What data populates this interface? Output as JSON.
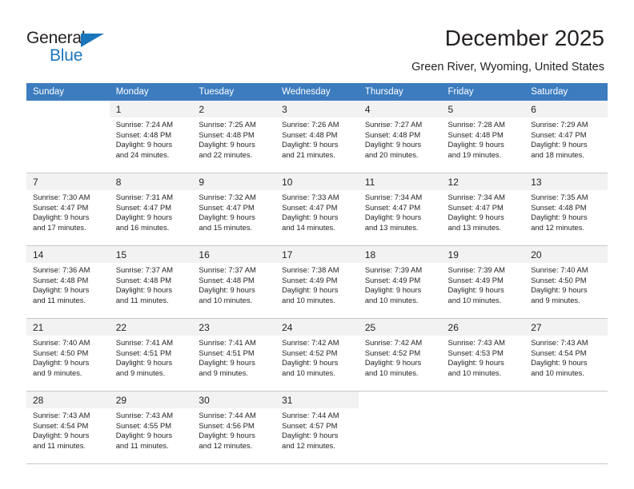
{
  "brand": {
    "name_top": "General",
    "name_bottom": "Blue",
    "accent_color": "#1b75bb",
    "triangle_icon": "triangle-icon"
  },
  "header": {
    "title": "December 2025",
    "subtitle": "Green River, Wyoming, United States"
  },
  "calendar": {
    "header_bg": "#3c7cbf",
    "header_text_color": "#ffffff",
    "datenum_bg": "#f2f2f2",
    "grid_line_color": "#c8c8c8",
    "weekdays": [
      "Sunday",
      "Monday",
      "Tuesday",
      "Wednesday",
      "Thursday",
      "Friday",
      "Saturday"
    ],
    "weeks": [
      [
        {
          "date": "",
          "sunrise": "",
          "sunset": "",
          "daylight_line1": "",
          "daylight_line2": "",
          "empty": true
        },
        {
          "date": "1",
          "sunrise": "Sunrise: 7:24 AM",
          "sunset": "Sunset: 4:48 PM",
          "daylight_line1": "Daylight: 9 hours",
          "daylight_line2": "and 24 minutes."
        },
        {
          "date": "2",
          "sunrise": "Sunrise: 7:25 AM",
          "sunset": "Sunset: 4:48 PM",
          "daylight_line1": "Daylight: 9 hours",
          "daylight_line2": "and 22 minutes."
        },
        {
          "date": "3",
          "sunrise": "Sunrise: 7:26 AM",
          "sunset": "Sunset: 4:48 PM",
          "daylight_line1": "Daylight: 9 hours",
          "daylight_line2": "and 21 minutes."
        },
        {
          "date": "4",
          "sunrise": "Sunrise: 7:27 AM",
          "sunset": "Sunset: 4:48 PM",
          "daylight_line1": "Daylight: 9 hours",
          "daylight_line2": "and 20 minutes."
        },
        {
          "date": "5",
          "sunrise": "Sunrise: 7:28 AM",
          "sunset": "Sunset: 4:48 PM",
          "daylight_line1": "Daylight: 9 hours",
          "daylight_line2": "and 19 minutes."
        },
        {
          "date": "6",
          "sunrise": "Sunrise: 7:29 AM",
          "sunset": "Sunset: 4:47 PM",
          "daylight_line1": "Daylight: 9 hours",
          "daylight_line2": "and 18 minutes."
        }
      ],
      [
        {
          "date": "7",
          "sunrise": "Sunrise: 7:30 AM",
          "sunset": "Sunset: 4:47 PM",
          "daylight_line1": "Daylight: 9 hours",
          "daylight_line2": "and 17 minutes."
        },
        {
          "date": "8",
          "sunrise": "Sunrise: 7:31 AM",
          "sunset": "Sunset: 4:47 PM",
          "daylight_line1": "Daylight: 9 hours",
          "daylight_line2": "and 16 minutes."
        },
        {
          "date": "9",
          "sunrise": "Sunrise: 7:32 AM",
          "sunset": "Sunset: 4:47 PM",
          "daylight_line1": "Daylight: 9 hours",
          "daylight_line2": "and 15 minutes."
        },
        {
          "date": "10",
          "sunrise": "Sunrise: 7:33 AM",
          "sunset": "Sunset: 4:47 PM",
          "daylight_line1": "Daylight: 9 hours",
          "daylight_line2": "and 14 minutes."
        },
        {
          "date": "11",
          "sunrise": "Sunrise: 7:34 AM",
          "sunset": "Sunset: 4:47 PM",
          "daylight_line1": "Daylight: 9 hours",
          "daylight_line2": "and 13 minutes."
        },
        {
          "date": "12",
          "sunrise": "Sunrise: 7:34 AM",
          "sunset": "Sunset: 4:47 PM",
          "daylight_line1": "Daylight: 9 hours",
          "daylight_line2": "and 13 minutes."
        },
        {
          "date": "13",
          "sunrise": "Sunrise: 7:35 AM",
          "sunset": "Sunset: 4:48 PM",
          "daylight_line1": "Daylight: 9 hours",
          "daylight_line2": "and 12 minutes."
        }
      ],
      [
        {
          "date": "14",
          "sunrise": "Sunrise: 7:36 AM",
          "sunset": "Sunset: 4:48 PM",
          "daylight_line1": "Daylight: 9 hours",
          "daylight_line2": "and 11 minutes."
        },
        {
          "date": "15",
          "sunrise": "Sunrise: 7:37 AM",
          "sunset": "Sunset: 4:48 PM",
          "daylight_line1": "Daylight: 9 hours",
          "daylight_line2": "and 11 minutes."
        },
        {
          "date": "16",
          "sunrise": "Sunrise: 7:37 AM",
          "sunset": "Sunset: 4:48 PM",
          "daylight_line1": "Daylight: 9 hours",
          "daylight_line2": "and 10 minutes."
        },
        {
          "date": "17",
          "sunrise": "Sunrise: 7:38 AM",
          "sunset": "Sunset: 4:49 PM",
          "daylight_line1": "Daylight: 9 hours",
          "daylight_line2": "and 10 minutes."
        },
        {
          "date": "18",
          "sunrise": "Sunrise: 7:39 AM",
          "sunset": "Sunset: 4:49 PM",
          "daylight_line1": "Daylight: 9 hours",
          "daylight_line2": "and 10 minutes."
        },
        {
          "date": "19",
          "sunrise": "Sunrise: 7:39 AM",
          "sunset": "Sunset: 4:49 PM",
          "daylight_line1": "Daylight: 9 hours",
          "daylight_line2": "and 10 minutes."
        },
        {
          "date": "20",
          "sunrise": "Sunrise: 7:40 AM",
          "sunset": "Sunset: 4:50 PM",
          "daylight_line1": "Daylight: 9 hours",
          "daylight_line2": "and 9 minutes."
        }
      ],
      [
        {
          "date": "21",
          "sunrise": "Sunrise: 7:40 AM",
          "sunset": "Sunset: 4:50 PM",
          "daylight_line1": "Daylight: 9 hours",
          "daylight_line2": "and 9 minutes."
        },
        {
          "date": "22",
          "sunrise": "Sunrise: 7:41 AM",
          "sunset": "Sunset: 4:51 PM",
          "daylight_line1": "Daylight: 9 hours",
          "daylight_line2": "and 9 minutes."
        },
        {
          "date": "23",
          "sunrise": "Sunrise: 7:41 AM",
          "sunset": "Sunset: 4:51 PM",
          "daylight_line1": "Daylight: 9 hours",
          "daylight_line2": "and 9 minutes."
        },
        {
          "date": "24",
          "sunrise": "Sunrise: 7:42 AM",
          "sunset": "Sunset: 4:52 PM",
          "daylight_line1": "Daylight: 9 hours",
          "daylight_line2": "and 10 minutes."
        },
        {
          "date": "25",
          "sunrise": "Sunrise: 7:42 AM",
          "sunset": "Sunset: 4:52 PM",
          "daylight_line1": "Daylight: 9 hours",
          "daylight_line2": "and 10 minutes."
        },
        {
          "date": "26",
          "sunrise": "Sunrise: 7:43 AM",
          "sunset": "Sunset: 4:53 PM",
          "daylight_line1": "Daylight: 9 hours",
          "daylight_line2": "and 10 minutes."
        },
        {
          "date": "27",
          "sunrise": "Sunrise: 7:43 AM",
          "sunset": "Sunset: 4:54 PM",
          "daylight_line1": "Daylight: 9 hours",
          "daylight_line2": "and 10 minutes."
        }
      ],
      [
        {
          "date": "28",
          "sunrise": "Sunrise: 7:43 AM",
          "sunset": "Sunset: 4:54 PM",
          "daylight_line1": "Daylight: 9 hours",
          "daylight_line2": "and 11 minutes."
        },
        {
          "date": "29",
          "sunrise": "Sunrise: 7:43 AM",
          "sunset": "Sunset: 4:55 PM",
          "daylight_line1": "Daylight: 9 hours",
          "daylight_line2": "and 11 minutes."
        },
        {
          "date": "30",
          "sunrise": "Sunrise: 7:44 AM",
          "sunset": "Sunset: 4:56 PM",
          "daylight_line1": "Daylight: 9 hours",
          "daylight_line2": "and 12 minutes."
        },
        {
          "date": "31",
          "sunrise": "Sunrise: 7:44 AM",
          "sunset": "Sunset: 4:57 PM",
          "daylight_line1": "Daylight: 9 hours",
          "daylight_line2": "and 12 minutes."
        },
        {
          "date": "",
          "sunrise": "",
          "sunset": "",
          "daylight_line1": "",
          "daylight_line2": "",
          "empty": true
        },
        {
          "date": "",
          "sunrise": "",
          "sunset": "",
          "daylight_line1": "",
          "daylight_line2": "",
          "empty": true
        },
        {
          "date": "",
          "sunrise": "",
          "sunset": "",
          "daylight_line1": "",
          "daylight_line2": "",
          "empty": true
        }
      ]
    ]
  }
}
